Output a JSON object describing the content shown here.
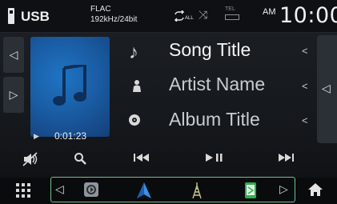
{
  "status_bar": {
    "source": "USB",
    "format_line1": "FLAC",
    "format_line2": "192kHz/24bit",
    "repeat_label": "ALL",
    "tel_label": "TEL",
    "ampm": "AM",
    "clock": "10:00"
  },
  "track": {
    "title": "Song Title",
    "artist": "Artist Name",
    "album": "Album Title",
    "elapsed": "0:01:23"
  },
  "icons": {
    "note": "music-note-icon",
    "artist": "person-icon",
    "album": "disc-icon",
    "mute": "speaker-mute-icon",
    "search": "search-icon",
    "prev": "skip-previous-icon",
    "playpause": "play-pause-icon",
    "next": "skip-next-icon",
    "home": "home-icon",
    "grid": "grid-menu-icon"
  },
  "colors": {
    "accent": "#6fc08f",
    "art_blue": "#1a5ea6",
    "background": "#15181c"
  }
}
